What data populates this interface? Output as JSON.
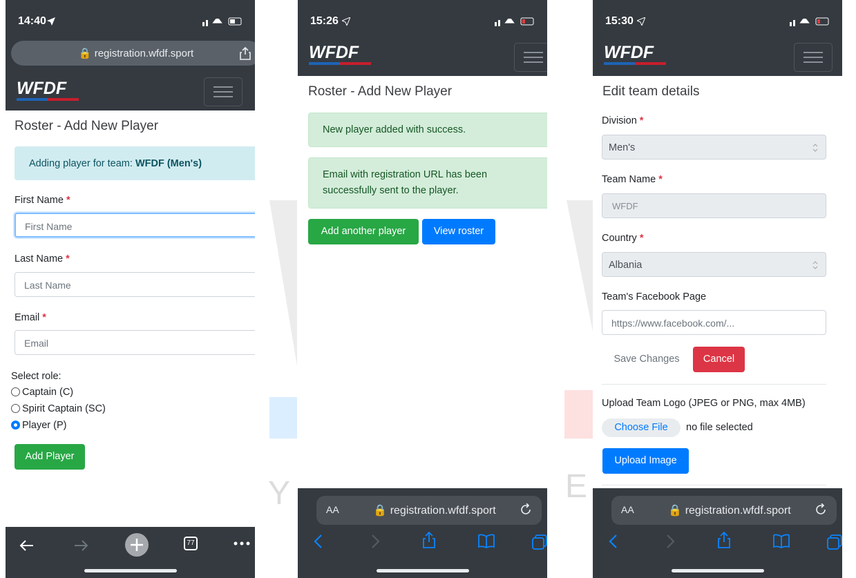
{
  "phone1": {
    "status_time": "14:40",
    "url": "registration.wfdf.sport",
    "logo_text": "WFDF",
    "page_title": "Roster - Add New Player",
    "alert_prefix": "Adding player for team: ",
    "alert_team": "WFDF (Men's)",
    "first_name_label": "First Name",
    "first_name_placeholder": "First Name",
    "last_name_label": "Last Name",
    "last_name_placeholder": "Last Name",
    "email_label": "Email",
    "email_placeholder": "Email",
    "required_mark": "*",
    "role_label": "Select role:",
    "roles": [
      {
        "label": "Captain (C)",
        "selected": false
      },
      {
        "label": "Spirit Captain (SC)",
        "selected": false
      },
      {
        "label": "Player (P)",
        "selected": true
      }
    ],
    "add_player_button": "Add Player",
    "tab_count": "77"
  },
  "phone2": {
    "status_time": "15:26",
    "logo_text": "WFDF",
    "page_title": "Roster - Add New Player",
    "success_message_1": "New player added with success.",
    "success_message_2": "Email with registration URL has been successfully sent to the player.",
    "add_another_button": "Add another player",
    "view_roster_button": "View roster",
    "url_aa": "AA",
    "url": "registration.wfdf.sport"
  },
  "phone3": {
    "status_time": "15:30",
    "logo_text": "WFDF",
    "page_title": "Edit team details",
    "division_label": "Division",
    "division_value": "Men's",
    "team_name_label": "Team Name",
    "team_name_value": "WFDF",
    "country_label": "Country",
    "country_value": "Albania",
    "facebook_label": "Team's Facebook Page",
    "facebook_placeholder": "https://www.facebook.com/...",
    "required_mark": "*",
    "save_button": "Save Changes",
    "cancel_button": "Cancel",
    "upload_label": "Upload Team Logo (JPEG or PNG, max 4MB)",
    "choose_file_button": "Choose File",
    "no_file_text": "no file selected",
    "upload_button": "Upload Image",
    "url_aa": "AA",
    "url": "registration.wfdf.sport"
  },
  "colors": {
    "navbar": "#343a40",
    "success_green": "#28a745",
    "primary_blue": "#007bff",
    "danger_red": "#dc3545",
    "info_bg": "#d1ecf1",
    "success_bg": "#d4edda"
  },
  "icons": [
    "navigation-arrow-icon",
    "signal-icon",
    "wifi-icon",
    "battery-icon",
    "lock-icon",
    "share-icon",
    "hamburger-menu-icon",
    "back-arrow-icon",
    "forward-arrow-icon",
    "new-tab-plus-icon",
    "tabs-icon",
    "more-icon",
    "reload-icon",
    "bookmarks-icon"
  ]
}
